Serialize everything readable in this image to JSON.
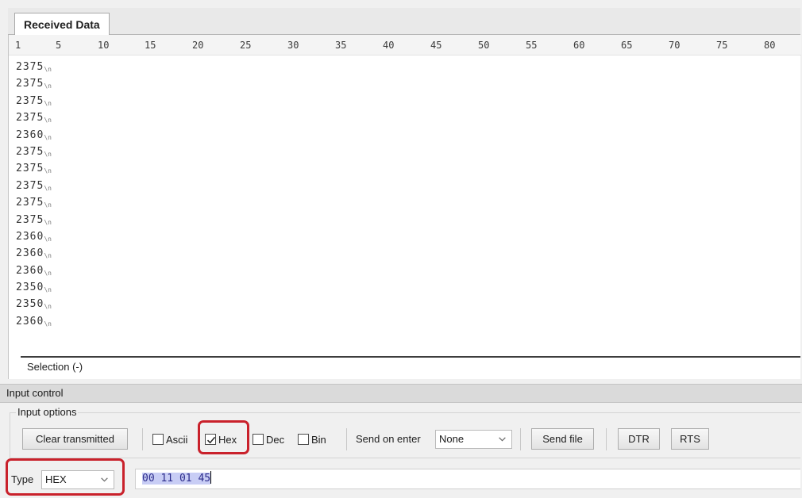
{
  "tabs": {
    "received_data": "Received Data"
  },
  "ruler": [
    "1",
    "5",
    "10",
    "15",
    "20",
    "25",
    "30",
    "35",
    "40",
    "45",
    "50",
    "55",
    "60",
    "65",
    "70",
    "75",
    "80"
  ],
  "received_rows": [
    "2375",
    "2375",
    "2375",
    "2375",
    "2360",
    "2375",
    "2375",
    "2375",
    "2375",
    "2375",
    "2360",
    "2360",
    "2360",
    "2350",
    "2350",
    "2360"
  ],
  "line_end_marker": "\\n",
  "selection": "Selection (-)",
  "input_control": {
    "title": "Input control",
    "group_label": "Input options",
    "clear_button": "Clear transmitted",
    "checkboxes": {
      "ascii": {
        "label": "Ascii",
        "checked": false
      },
      "hex": {
        "label": "Hex",
        "checked": true
      },
      "dec": {
        "label": "Dec",
        "checked": false
      },
      "bin": {
        "label": "Bin",
        "checked": false
      }
    },
    "send_on_enter_label": "Send on enter",
    "send_on_enter_value": "None",
    "send_file_button": "Send file",
    "dtr_button": "DTR",
    "rts_button": "RTS",
    "type_label": "Type",
    "type_value": "HEX",
    "hex_input": "00 11 01 45"
  },
  "highlight_color": "#c9212b"
}
